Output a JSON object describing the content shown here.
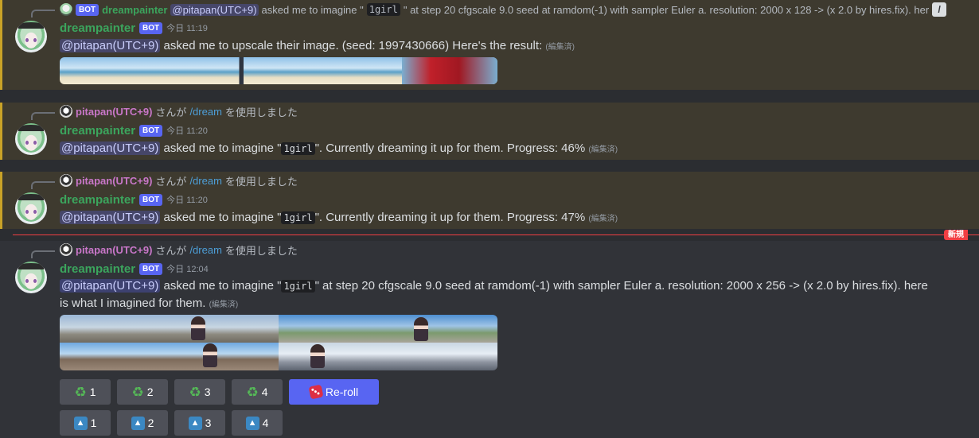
{
  "msg1": {
    "ref": {
      "bot_tag": "BOT",
      "author": "dreampainter",
      "mention": "@pitapan(UTC+9)",
      "text_a": "asked me to imagine \"",
      "code": "1girl",
      "text_b": "\" at step 20 cfgscale 9.0 seed at ramdom(-1) with sampler Euler a. resolution: 2000 x 128 -> (x 2.0 by hires.fix). her",
      "edit_icon": "pencil-icon"
    },
    "author": "dreampainter",
    "bot_tag": "BOT",
    "time": "今日 11:19",
    "mention": "@pitapan(UTC+9)",
    "text": " asked me to upscale their image. (seed: 1997430666) Here's the result:",
    "edited": "(編集済)"
  },
  "msg2": {
    "ref_user": "pitapan(UTC+9)",
    "ref_a": "さんが",
    "ref_cmd": "/dream",
    "ref_b": "を使用しました",
    "author": "dreampainter",
    "bot_tag": "BOT",
    "time": "今日 11:20",
    "mention": "@pitapan(UTC+9)",
    "text_a": " asked me to imagine \"",
    "code": "1girl",
    "text_b": "\". Currently dreaming it up for them. Progress: 46%",
    "edited": "(編集済)"
  },
  "msg3": {
    "ref_user": "pitapan(UTC+9)",
    "ref_a": "さんが",
    "ref_cmd": "/dream",
    "ref_b": "を使用しました",
    "author": "dreampainter",
    "bot_tag": "BOT",
    "time": "今日 11:20",
    "mention": "@pitapan(UTC+9)",
    "text_a": " asked me to imagine \"",
    "code": "1girl",
    "text_b": "\". Currently dreaming it up for them. Progress: 47%",
    "edited": "(編集済)"
  },
  "new_badge": "新規",
  "msg4": {
    "ref_user": "pitapan(UTC+9)",
    "ref_a": "さんが",
    "ref_cmd": "/dream",
    "ref_b": "を使用しました",
    "author": "dreampainter",
    "bot_tag": "BOT",
    "time": "今日 12:04",
    "mention": "@pitapan(UTC+9)",
    "text_a": " asked me to imagine \"",
    "code": "1girl",
    "text_b": "\" at step 20 cfgscale 9.0 seed at ramdom(-1) with sampler Euler a. resolution: 2000 x 256 -> (x 2.0 by hires.fix). here is what I imagined for them.",
    "edited": "(編集済)",
    "reroll_buttons": [
      "1",
      "2",
      "3",
      "4"
    ],
    "reroll_label": "Re-roll",
    "upscale_buttons": [
      "1",
      "2",
      "3",
      "4"
    ]
  },
  "icons": {
    "reroll": "recycle-icon",
    "dice": "dice-icon",
    "upscale": "arrow-up-icon"
  },
  "colors": {
    "bot_tag": "#5865f2",
    "author": "#3ba55d",
    "highlight_bg": "#3e3a2f",
    "highlight_border": "#c9a227",
    "new_divider": "#f23f43",
    "reroll_button": "#5865f2"
  }
}
